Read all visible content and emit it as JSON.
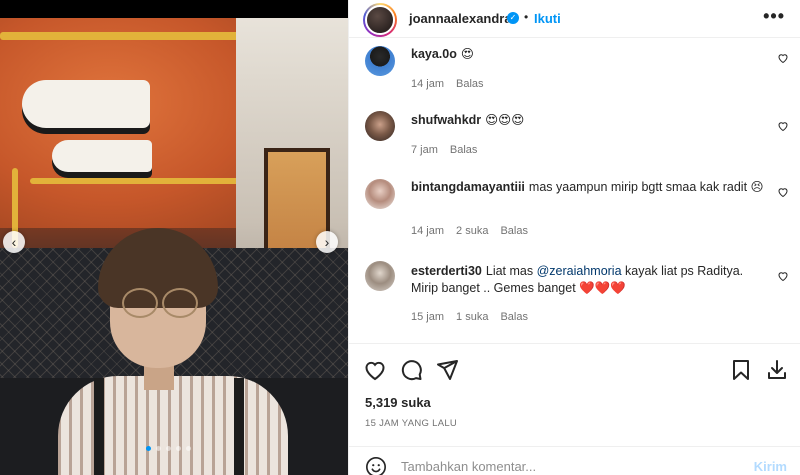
{
  "post": {
    "username": "joannaalexandra",
    "separator": "•",
    "follow_label": "Ikuti",
    "more_label": "•••",
    "likes": "5,319 suka",
    "time": "15 JAM YANG LALU"
  },
  "comments": [
    {
      "username": "kaya.0o",
      "text": "😍",
      "time": "14 jam",
      "likes": "",
      "reply": "Balas"
    },
    {
      "username": "shufwahkdr",
      "text": "😍😍😍",
      "time": "7 jam",
      "likes": "",
      "reply": "Balas"
    },
    {
      "username": "bintangdamayantiii",
      "text": "mas yaampun mirip bgtt smaa kak radit 😣",
      "time": "14 jam",
      "likes": "2 suka",
      "reply": "Balas"
    },
    {
      "username": "esterderti30",
      "text_pre": "Liat mas ",
      "mention": "@zeraiahmoria",
      "text_post": " kayak liat ps Raditya. Mirip banget .. Gemes banget ❤️❤️❤️",
      "time": "15 jam",
      "likes": "1 suka",
      "reply": "Balas"
    }
  ],
  "composer": {
    "placeholder": "Tambahkan komentar...",
    "post_label": "Kirim"
  },
  "carousel": {
    "slide_count": 5,
    "active_index": 0
  },
  "colors": {
    "accent": "#0095f6",
    "heart_red": "#ed4956",
    "text": "#262626",
    "muted": "#737373"
  }
}
